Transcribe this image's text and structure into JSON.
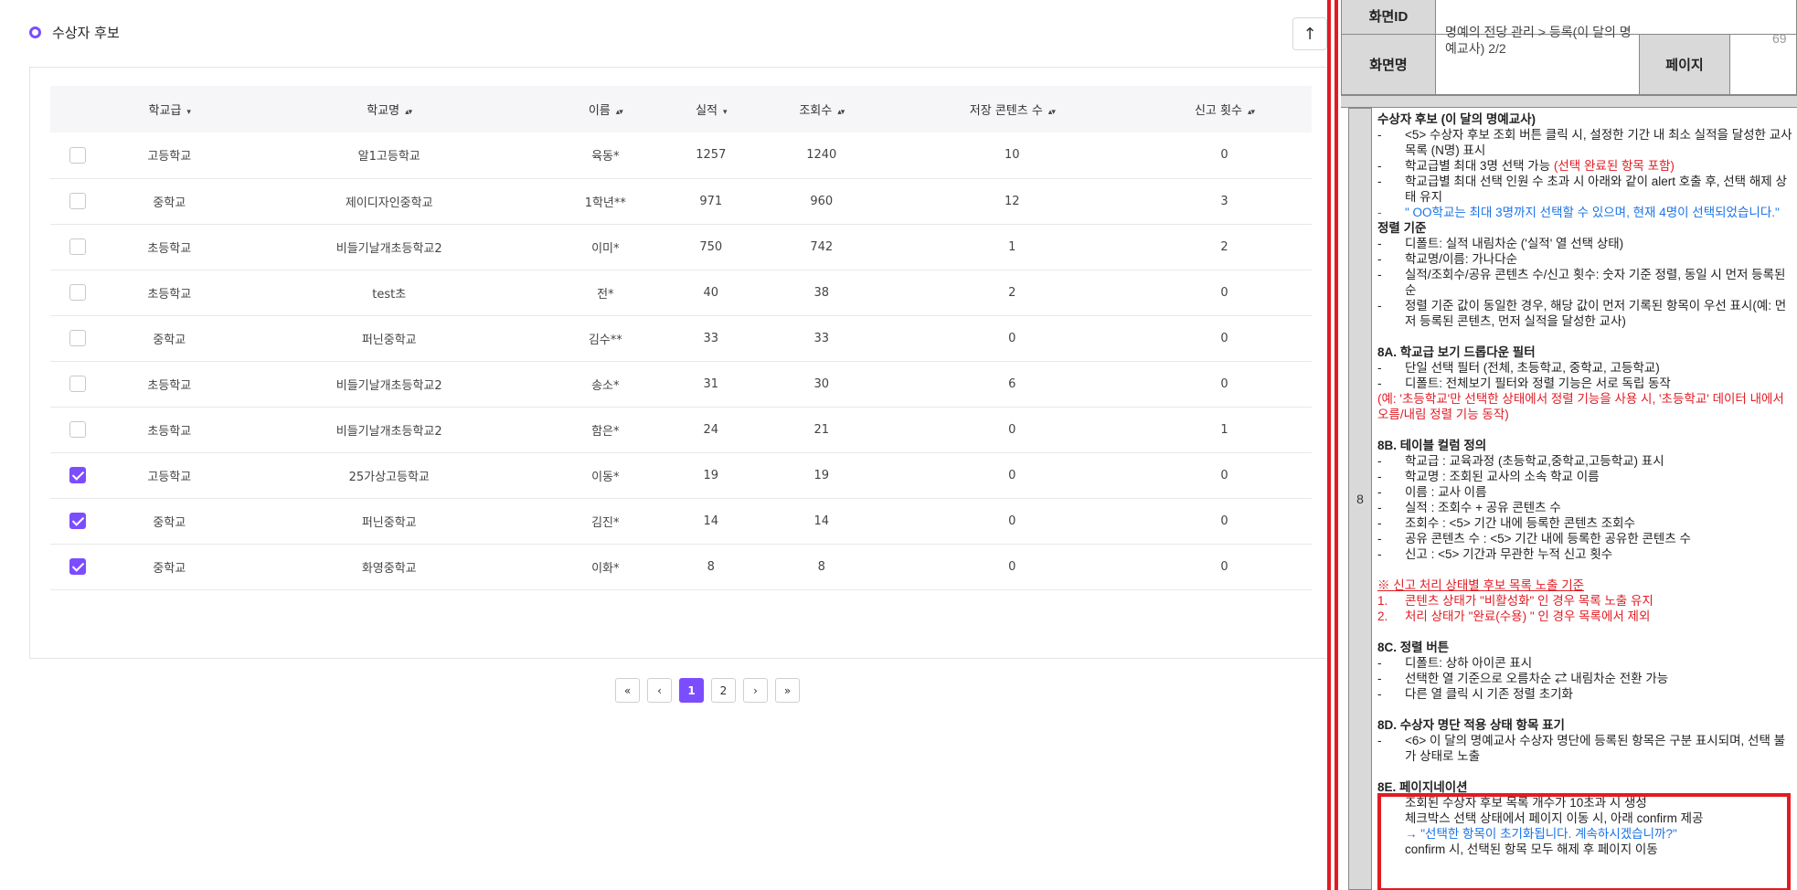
{
  "section": {
    "title": "수상자 후보"
  },
  "up_button": {
    "icon": "arrow-up-icon",
    "glyph": "↑"
  },
  "table": {
    "headers": [
      {
        "label": "학교급",
        "sort": "▾"
      },
      {
        "label": "학교명",
        "sort": "▴▾"
      },
      {
        "label": "이름",
        "sort": "▴▾"
      },
      {
        "label": "실적",
        "sort": "▾"
      },
      {
        "label": "조회수",
        "sort": "▴▾"
      },
      {
        "label": "저장 콘텐츠 수",
        "sort": "▴▾"
      },
      {
        "label": "신고 횟수",
        "sort": "▴▾"
      }
    ],
    "rows": [
      {
        "checked": false,
        "level": "고등학교",
        "school": "알1고등학교",
        "name": "육동*",
        "perf": "1257",
        "views": "1240",
        "saved": "10",
        "reports": "0"
      },
      {
        "checked": false,
        "level": "중학교",
        "school": "제이디자인중학교",
        "name": "1학년**",
        "perf": "971",
        "views": "960",
        "saved": "12",
        "reports": "3"
      },
      {
        "checked": false,
        "level": "초등학교",
        "school": "비들기날개초등학교2",
        "name": "이미*",
        "perf": "750",
        "views": "742",
        "saved": "1",
        "reports": "2"
      },
      {
        "checked": false,
        "level": "초등학교",
        "school": "test초",
        "name": "전*",
        "perf": "40",
        "views": "38",
        "saved": "2",
        "reports": "0"
      },
      {
        "checked": false,
        "level": "중학교",
        "school": "퍼닌중학교",
        "name": "김수**",
        "perf": "33",
        "views": "33",
        "saved": "0",
        "reports": "0"
      },
      {
        "checked": false,
        "level": "초등학교",
        "school": "비들기날개초등학교2",
        "name": "송소*",
        "perf": "31",
        "views": "30",
        "saved": "6",
        "reports": "0"
      },
      {
        "checked": false,
        "level": "초등학교",
        "school": "비들기날개초등학교2",
        "name": "함은*",
        "perf": "24",
        "views": "21",
        "saved": "0",
        "reports": "1"
      },
      {
        "checked": true,
        "level": "고등학교",
        "school": "25가상고등학교",
        "name": "이동*",
        "perf": "19",
        "views": "19",
        "saved": "0",
        "reports": "0"
      },
      {
        "checked": true,
        "level": "중학교",
        "school": "퍼닌중학교",
        "name": "김진*",
        "perf": "14",
        "views": "14",
        "saved": "0",
        "reports": "0"
      },
      {
        "checked": true,
        "level": "중학교",
        "school": "화영중학교",
        "name": "이화*",
        "perf": "8",
        "views": "8",
        "saved": "0",
        "reports": "0"
      }
    ]
  },
  "pagination": {
    "first": "«",
    "prev": "‹",
    "pages": [
      "1",
      "2"
    ],
    "current": "1",
    "next": "›",
    "last": "»"
  },
  "spec": {
    "screen_id_label": "화면ID",
    "screen_name_label": "화면명",
    "screen_name_value": "명예의 전당 관리 > 등록(이 달의 명예교사) 2/2",
    "page_label": "페이지",
    "page_number": "69",
    "row_number": "8",
    "lines": [
      {
        "t": "h",
        "text": "수상자 후보 (이 달의 명예교사)"
      },
      {
        "t": "li",
        "b": "-",
        "text": "<5> 수상자 후보 조회 버튼 클릭 시, 설정한 기간 내 최소 실적을 달성한 교사 목록 (N명) 표시"
      },
      {
        "t": "li",
        "b": "-",
        "text": "학교급별 최대 3명 선택 가능 ",
        "extra": "(선택 완료된 항목 포함)",
        "extra_c": "red"
      },
      {
        "t": "li",
        "b": "-",
        "text": "학교급별 최대 선택 인원 수 초과 시 아래와 같이 alert 호출 후, 선택 해제 상태 유지"
      },
      {
        "t": "li",
        "b": "-",
        "text": "\" OO학교는 최대 3명까지 선택할 수 있으며, 현재 4명이 선택되었습니다.\"",
        "c": "blue"
      },
      {
        "t": "h",
        "text": "정렬 기준"
      },
      {
        "t": "li",
        "b": "-",
        "text": "디폴트: 실적 내림차순 ('실적' 열 선택 상태)"
      },
      {
        "t": "li",
        "b": "-",
        "text": "학교명/이름: 가나다순"
      },
      {
        "t": "li",
        "b": "-",
        "text": "실적/조회수/공유 콘텐츠 수/신고 횟수: 숫자 기준 정렬, 동일 시 먼저 등록된 순"
      },
      {
        "t": "li",
        "b": "-",
        "text": "정렬 기준 값이 동일한 경우, 해당 값이 먼저 기록된 항목이 우선 표시(예: 먼저 등록된 콘텐츠, 먼저 실적을 달성한 교사)"
      },
      {
        "t": "gap"
      },
      {
        "t": "h",
        "text": "8A. 학교급 보기 드롭다운 필터"
      },
      {
        "t": "li",
        "b": "-",
        "text": "단일 선택 필터 (전체, 초등학교, 중학교, 고등학교)"
      },
      {
        "t": "li",
        "b": "-",
        "text": "디폴트: 전체보기 필터와 정렬 기능은 서로 독립 동작"
      },
      {
        "t": "p",
        "text": "(예: '초등학교'만 선택한 상태에서 정렬 기능을 사용 시, '초등학교' 데이터 내에서 오름/내림 정렬 기능 동작)",
        "c": "red"
      },
      {
        "t": "gap"
      },
      {
        "t": "h",
        "text": "8B. 테이블 컬럼 정의"
      },
      {
        "t": "li",
        "b": "-",
        "text": "학교급 : 교육과정 (초등학교,중학교,고등학교) 표시"
      },
      {
        "t": "li",
        "b": "-",
        "text": "학교명 : 조회된 교사의 소속 학교 이름"
      },
      {
        "t": "li",
        "b": "-",
        "text": "이름 : 교사 이름"
      },
      {
        "t": "li",
        "b": "-",
        "text": "실적 : 조회수 + 공유 콘텐츠 수"
      },
      {
        "t": "li",
        "b": "-",
        "text": "조회수 : <5> 기간 내에 등록한 콘텐츠 조회수"
      },
      {
        "t": "li",
        "b": "-",
        "text": "공유 콘텐츠 수 : <5> 기간 내에 등록한 공유한 콘텐츠 수"
      },
      {
        "t": "li",
        "b": "-",
        "text": "신고 : <5> 기간과 무관한 누적 신고 횟수"
      },
      {
        "t": "gap"
      },
      {
        "t": "p",
        "text": "※ 신고 처리 상태별 후보 목록 노출 기준",
        "c": "red ul"
      },
      {
        "t": "li",
        "b": "1.",
        "text": "콘텐츠 상태가 \"비활성화\" 인 경우 목록 노출 유지",
        "c": "red"
      },
      {
        "t": "li",
        "b": "2.",
        "text": "처리 상태가 \"완료(수용) \" 인 경우 목록에서 제외",
        "c": "red"
      },
      {
        "t": "gap"
      },
      {
        "t": "h",
        "text": "8C. 정렬 버튼"
      },
      {
        "t": "li",
        "b": "-",
        "text": "디폴트: 상하 아이콘 표시"
      },
      {
        "t": "li",
        "b": "-",
        "text": "선택한 열 기준으로 오름차순 ⇄ 내림차순 전환 가능"
      },
      {
        "t": "li",
        "b": "-",
        "text": "다른 열 클릭 시 기존 정렬 초기화"
      },
      {
        "t": "gap"
      },
      {
        "t": "h",
        "text": "8D. 수상자 명단 적용 상태 항목 표기"
      },
      {
        "t": "li",
        "b": "-",
        "text": "<6> 이 달의 명예교사 수상자 명단에 등록된 항목은 구분 표시되며, 선택 불가 상태로 노출"
      },
      {
        "t": "gap"
      },
      {
        "t": "h",
        "text": "8E. 페이지네이션"
      },
      {
        "t": "li",
        "b": "-",
        "text": "조회된 수상자 후보 목록 개수가 10초과 시 생성"
      },
      {
        "t": "li",
        "b": "-",
        "text": "체크박스 선택 상태에서 페이지 이동 시, 아래 confirm 제공"
      },
      {
        "t": "p",
        "text": "→ \"선택한 항목이 초기화됩니다. 계속하시겠습니까?\"",
        "c": "blue",
        "indent": true
      },
      {
        "t": "li",
        "b": "-",
        "text": "confirm 시, 선택된 항목 모두 해제 후 페이지 이동"
      }
    ]
  },
  "colors": {
    "accent": "#7c4dff",
    "annotation_red": "#e21b23",
    "note_blue": "#1a73e8"
  }
}
